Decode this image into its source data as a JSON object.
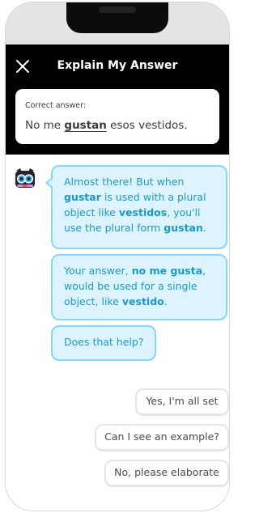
{
  "header": {
    "title": "Explain My Answer"
  },
  "answer_card": {
    "label": "Correct answer:",
    "prefix": "No me ",
    "highlight": "gustan",
    "suffix": " esos vestidos."
  },
  "messages": {
    "m1": {
      "t1": "Almost there! But when ",
      "t2": "gustar",
      "t3": " is used with a plural object like ",
      "t4": "vestidos",
      "t5": ", you'll use the plural form ",
      "t6": "gustan",
      "t7": "."
    },
    "m2": {
      "t1": "Your answer, ",
      "t2": "no me gusta",
      "t3": ", would be used for a single object, like ",
      "t4": "vestido",
      "t5": "."
    },
    "m3": {
      "t1": "Does that help?"
    }
  },
  "replies": [
    "Yes, I'm all set",
    "Can I see an example?",
    "No, please elaborate"
  ],
  "icons": {
    "close": "close-icon",
    "avatar": "owl-avatar-icon"
  },
  "colors": {
    "bubble_bg": "#ddf4ff",
    "bubble_border": "#84d8ff",
    "bubble_text": "#1899d6",
    "header_bg": "#000000"
  }
}
